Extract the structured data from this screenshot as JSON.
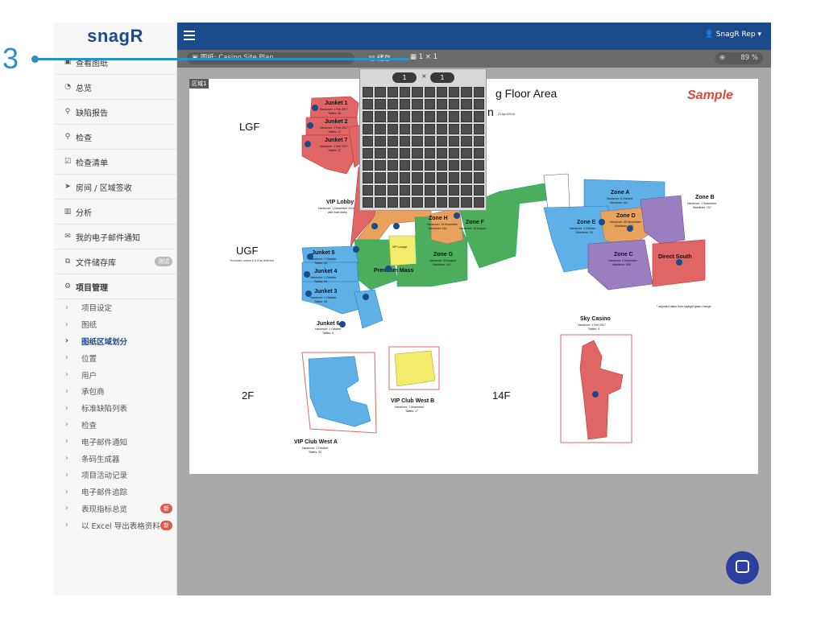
{
  "logo": "snagR",
  "nav": {
    "items": [
      {
        "icon": "image-icon",
        "glyph": "▣",
        "label": "查看图纸"
      },
      {
        "icon": "dashboard-icon",
        "glyph": "◔",
        "label": "总览"
      },
      {
        "icon": "map-marker-icon",
        "glyph": "⚲",
        "label": "缺陷报告"
      },
      {
        "icon": "search-icon",
        "glyph": "⚲",
        "label": "检查"
      },
      {
        "icon": "checklist-icon",
        "glyph": "☑",
        "label": "检查清单"
      },
      {
        "icon": "send-icon",
        "glyph": "➤",
        "label": "房间 / 区域签收"
      },
      {
        "icon": "bar-chart-icon",
        "glyph": "▥",
        "label": "分析"
      },
      {
        "icon": "envelope-icon",
        "glyph": "✉",
        "label": "我的电子邮件通知"
      },
      {
        "icon": "copy-icon",
        "glyph": "⧉",
        "label": "文件储存库",
        "badge": "测试"
      },
      {
        "icon": "cogs-icon",
        "glyph": "⚙",
        "label": "项目管理"
      }
    ],
    "sub_items": [
      {
        "label": "项目设定"
      },
      {
        "label": "图纸"
      },
      {
        "label": "图纸区域划分",
        "active": true
      },
      {
        "label": "位置"
      },
      {
        "label": "用户"
      },
      {
        "label": "承包商"
      },
      {
        "label": "标准缺陷列表"
      },
      {
        "label": "检查"
      },
      {
        "label": "电子邮件通知"
      },
      {
        "label": "条码生成器"
      },
      {
        "label": "项目活动记录"
      },
      {
        "label": "电子邮件追踪"
      },
      {
        "label": "表现指标总览",
        "badge": "新"
      },
      {
        "label": "以 Excel 导出表格资料",
        "badge": "新"
      }
    ]
  },
  "topbar": {
    "user": "SnagR Rep ▾"
  },
  "toolbar": {
    "drawing_label": "▣ 图纸: Casino Site Plan",
    "save_label": "🖫 储存",
    "grid_label": "▦ 1 × 1",
    "zoom_icon": "⊕",
    "zoom_value": "89 %"
  },
  "grid_popup": {
    "cols": "1",
    "rows": "1",
    "times": "×"
  },
  "area_tag": "区域1",
  "plan": {
    "title": "g Floor Area",
    "title2": "n",
    "date": "21April2016",
    "sample": "Sample",
    "floors": [
      "LGF",
      "UGF",
      "2F",
      "14F"
    ],
    "junkets": [
      {
        "name": "Junket 1",
        "info": "Handover: 1 Feb 2017",
        "tables": "Tables: 18"
      },
      {
        "name": "Junket 2",
        "info": "Handover: 1 Feb 2017",
        "tables": "Tables: 17"
      },
      {
        "name": "Junket 7",
        "info": "Handover: 1 Feb 2017",
        "tables": "Tables: 27"
      },
      {
        "name": "Junket 5",
        "info": "Handover: 1 October",
        "tables": "Tables: 16"
      },
      {
        "name": "Junket 4",
        "info": "Handover: 1 October",
        "tables": "Tables: 34"
      },
      {
        "name": "Junket 3",
        "info": "Handover: 1 October",
        "tables": "Tables: 25"
      },
      {
        "name": "Junket 6",
        "info": "Handover: 1 October",
        "tables": "Tables: 9"
      }
    ],
    "vip_lobby": "VIP Lobby",
    "vip_lobby_info": "Handover: 1 December 2016",
    "vip_lobby_info2": "with hotel lobby",
    "ugf_note": "*excludes current 6 & 8 as deferred",
    "zones": [
      {
        "name": "Zone A",
        "info": "Handover: 6 October",
        "machines": "Machines: 411"
      },
      {
        "name": "Zone B",
        "info": "Handover: 1 November",
        "machines": "Machines: 157"
      },
      {
        "name": "Zone C",
        "info": "Handover: 2 November",
        "machines": "Machines: 669"
      },
      {
        "name": "Zone D",
        "info": "Handover: 30 November*",
        "machines": "Machines: 106"
      },
      {
        "name": "Zone E",
        "info": "Handover: 4 October",
        "machines": "Machines: 94"
      },
      {
        "name": "Zone F",
        "info": "Handover: 15 August",
        "machines": "Tables: 36"
      },
      {
        "name": "Zone G",
        "info": "Handover: 30 August",
        "machines": "Machines: 161"
      },
      {
        "name": "Zone H",
        "info": "Handover: 15 November",
        "machines": "Machines: 116"
      }
    ],
    "direct_south": "Direct South",
    "premium_mass": "Premium Mass",
    "vip_lounge": "VIP Lounge",
    "adjusted_note": "* adjusted dates from kaylight glass change",
    "sky_casino": "Sky Casino",
    "sky_casino_info": "Handover: 1 Feb 2017",
    "sky_casino_tables": "Tables: 9",
    "vip_west_a": "VIP Club West A",
    "vip_west_a_info": "Handover: 1 October",
    "vip_west_a_tables": "Tables: 33",
    "vip_west_b": "VIP Club West B",
    "vip_west_b_info": "Handover: 1 November",
    "vip_west_b_tables": "Tables: 17",
    "colors": {
      "red": "#e06565",
      "blue": "#5fb0e6",
      "green": "#4cae5c",
      "purple": "#9a7fc0",
      "orange": "#e8a25c",
      "yellow": "#f2ec6a"
    }
  },
  "step": {
    "number": "3"
  }
}
